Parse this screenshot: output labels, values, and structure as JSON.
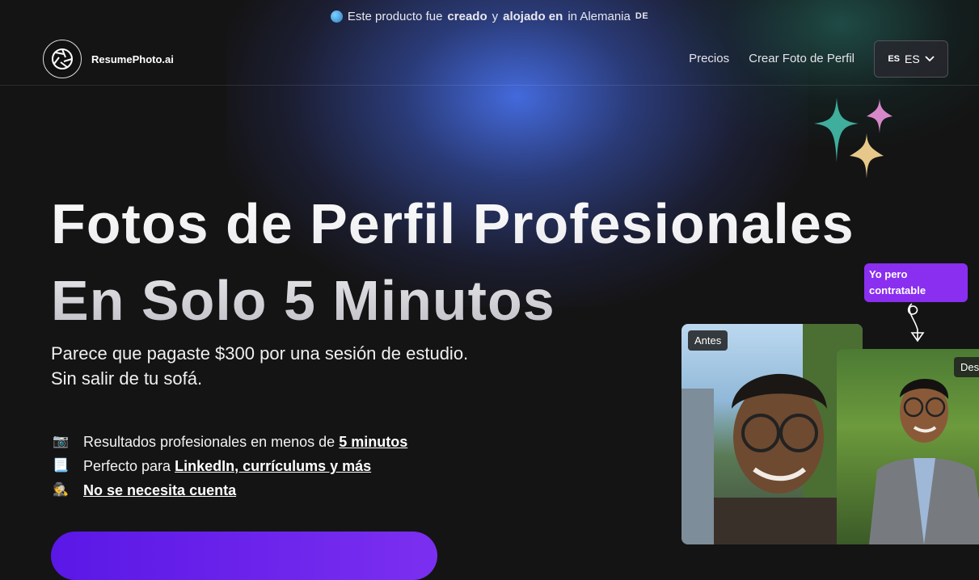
{
  "banner": {
    "prefix": "Este producto fue",
    "created": "creado",
    "and": "y",
    "hosted": "alojado en",
    "location": "in Alemania",
    "country_code": "DE"
  },
  "brand": {
    "name": "ResumePhoto.ai"
  },
  "nav": {
    "links": [
      "Precios",
      "Crear Foto de Perfil"
    ],
    "language": {
      "code_small": "ES",
      "code": "ES"
    }
  },
  "hero": {
    "title_line1": "Fotos de Perfil Profesionales",
    "title_line2": "En Solo 5 Minutos",
    "subtitle_line1": "Parece que pagaste $300 por una sesión de estudio.",
    "subtitle_line2": "Sin salir de tu sofá."
  },
  "features": [
    {
      "icon": "camera-icon",
      "text": "Resultados profesionales en menos de",
      "link": "5 minutos"
    },
    {
      "icon": "document-icon",
      "text": "Perfecto para",
      "link": "LinkedIn, currículums y más"
    },
    {
      "icon": "incognito-icon",
      "text": "",
      "link": "No se necesita cuenta"
    }
  ],
  "comparison": {
    "before_label": "Antes",
    "after_label": "Des",
    "callout": "Yo pero contratable"
  },
  "colors": {
    "accent": "#7b2ff0",
    "background": "#141414",
    "glow": "#4a6fe0"
  }
}
